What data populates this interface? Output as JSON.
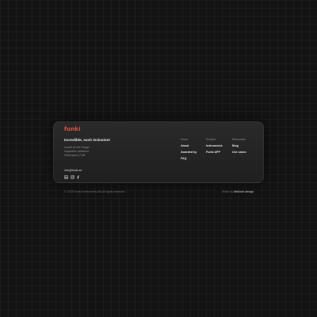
{
  "brand": {
    "name": "funki",
    "color": "#e0523d"
  },
  "tagline": "Incredible, such inclusion!",
  "awards": [
    "Award at Ime Ringer",
    "Inspiration weekend",
    "Participant | FUB"
  ],
  "email": "info@funki.se",
  "socials": [
    {
      "icon": "linkedin-icon"
    },
    {
      "icon": "instagram-icon"
    },
    {
      "icon": "facebook-icon"
    }
  ],
  "nav": {
    "home": {
      "title": "Home",
      "links": [
        "About",
        "Awarded by",
        "FAQ"
      ]
    },
    "product": {
      "title": "Product",
      "links": [
        "Instruments",
        "Funki APP"
      ]
    },
    "resources": {
      "title": "Resources",
      "links": [
        "Blog",
        "Use cases"
      ]
    }
  },
  "footer": {
    "copyright": "© 2025 Funki Instruments AB All rights reserved",
    "made_by_label": "Made by",
    "made_by_link": "Mekloch design"
  }
}
